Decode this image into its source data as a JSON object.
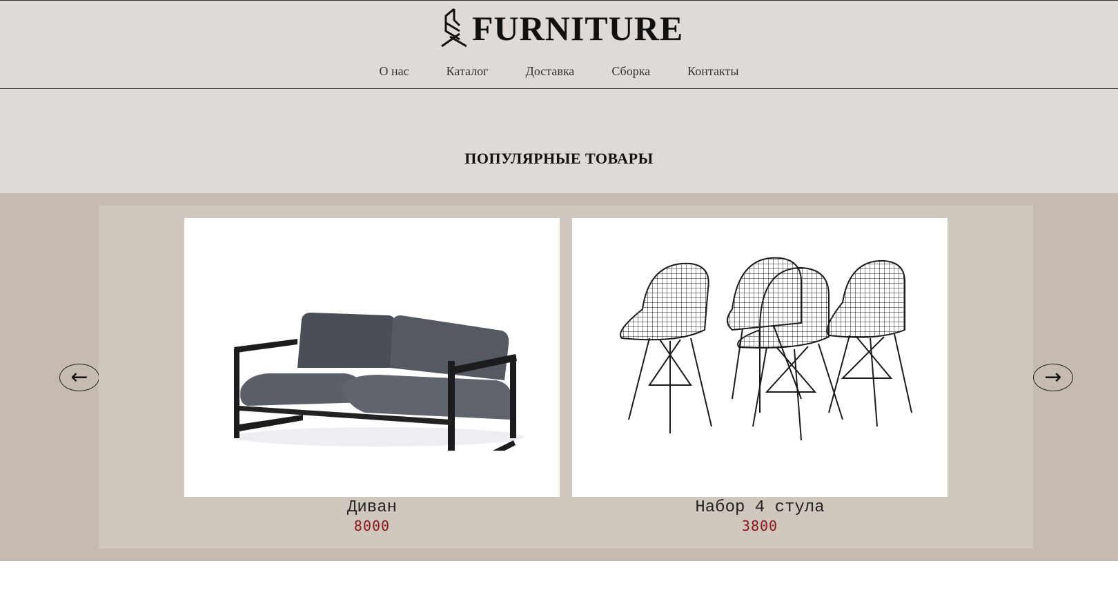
{
  "brand": {
    "name": "FURNITURE",
    "logo_icon": "chair-outline-icon"
  },
  "nav": {
    "items": [
      {
        "label": "О нас"
      },
      {
        "label": "Каталог"
      },
      {
        "label": "Доставка"
      },
      {
        "label": "Сборка"
      },
      {
        "label": "Контакты"
      }
    ]
  },
  "section": {
    "title": "ПОПУЛЯРНЫЕ ТОВАРЫ"
  },
  "carousel": {
    "prev_label": "←",
    "next_label": "→",
    "products": [
      {
        "name": "Диван",
        "price": "8000",
        "image_icon": "sofa-image"
      },
      {
        "name": "Набор 4 стула",
        "price": "3800",
        "image_icon": "wire-chairs-image"
      }
    ]
  },
  "colors": {
    "header_bg": "#dfdad5",
    "carousel_bg": "#c5bbb1",
    "carousel_inner_bg": "#d0c7be",
    "price": "#8b1414"
  }
}
